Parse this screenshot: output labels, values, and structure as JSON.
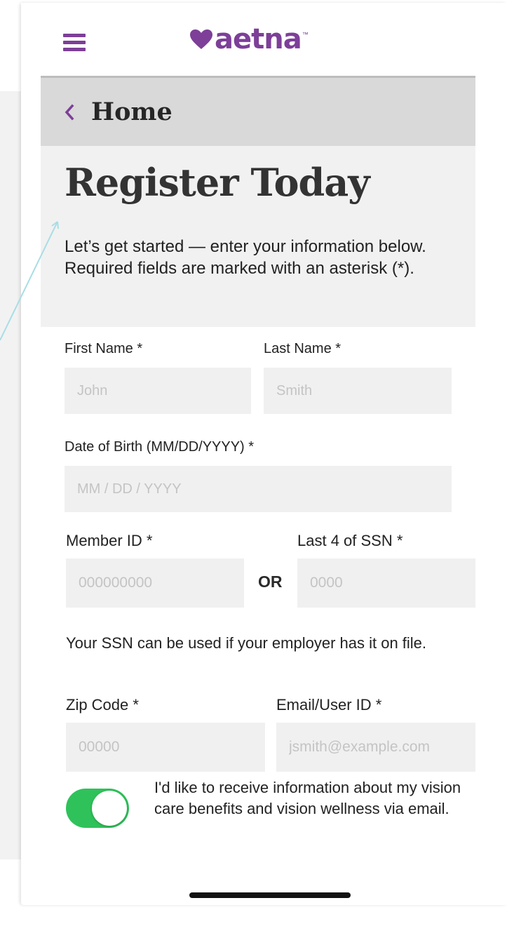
{
  "colors": {
    "brand_purple": "#7d3f98",
    "toggle_on": "#2fc25a",
    "breadcrumb_bg": "#d9d9d9",
    "panel_bg": "#f1f1f1",
    "input_bg": "#f0f0f0",
    "annotation_line": "#a8dde6"
  },
  "header": {
    "menu_icon": "hamburger-menu-icon",
    "logo_text": "aetna",
    "logo_tm": "™"
  },
  "breadcrumb": {
    "back_icon": "chevron-left-icon",
    "label": "Home"
  },
  "intro": {
    "title": "Register Today",
    "text": "Let’s get started — enter your information below. Required fields are marked with an asterisk (*)."
  },
  "form": {
    "first_name": {
      "label": "First Name *",
      "placeholder": "John",
      "value": ""
    },
    "last_name": {
      "label": "Last Name *",
      "placeholder": "Smith",
      "value": ""
    },
    "dob": {
      "label": "Date of Birth (MM/DD/YYYY) *",
      "placeholder": "MM / DD / YYYY",
      "value": ""
    },
    "member_id": {
      "label": "Member ID *",
      "placeholder": "000000000",
      "value": ""
    },
    "or_label": "OR",
    "ssn_last4": {
      "label": "Last 4 of SSN *",
      "placeholder": "0000",
      "value": ""
    },
    "ssn_note": "Your SSN can be used if your employer has it on file.",
    "zip": {
      "label": "Zip Code *",
      "placeholder": "00000",
      "value": ""
    },
    "email": {
      "label": "Email/User ID *",
      "placeholder": "jsmith@example.com",
      "value": ""
    },
    "email_optin": {
      "enabled": true,
      "text": "I'd like to receive information about my vision care benefits and vision wellness via email."
    }
  }
}
